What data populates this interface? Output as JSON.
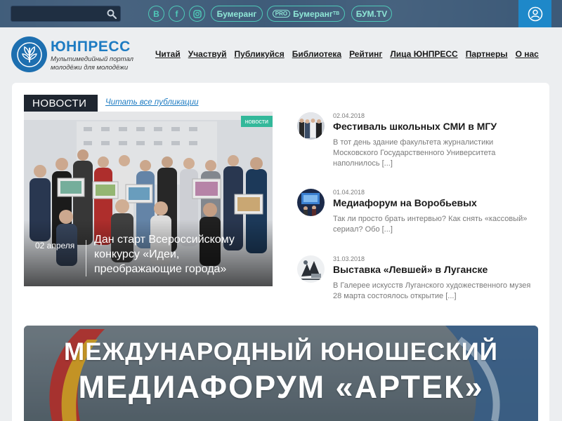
{
  "topbar": {
    "search": {
      "value": "",
      "placeholder": ""
    },
    "social": [
      {
        "icon": "vk-icon",
        "glyph": "В"
      },
      {
        "icon": "facebook-icon",
        "glyph": "f"
      },
      {
        "icon": "instagram-icon",
        "glyph": ""
      }
    ],
    "links": [
      {
        "label": "Бумеранг"
      },
      {
        "pro": "PRO",
        "label": "Бумеранг",
        "sup": "ТВ"
      },
      {
        "label": "БУМ.TV"
      }
    ],
    "user_icon": "user-icon"
  },
  "header": {
    "logo_title": "ЮНПРЕСС",
    "logo_subtitle": "Мультимедийный портал молодёжи для молодёжи",
    "nav": [
      "Читай",
      "Участвуй",
      "Публикуйся",
      "Библиотека",
      "Рейтинг",
      "Лица ЮНПРЕСС",
      "Партнеры",
      "О нас"
    ]
  },
  "news": {
    "tab_label": "НОВОСТИ",
    "read_all": "Читать все публикации",
    "hero": {
      "badge": "новости",
      "date": "02 апреля",
      "title": "Дан старт Всероссийскому конкурсу «Идеи, преображающие города»"
    },
    "items": [
      {
        "date": "02.04.2018",
        "title": "Фестиваль школьных СМИ в МГУ",
        "text": "В тот день здание факультета журналистики Московского Государственного Университета наполнилось [...]"
      },
      {
        "date": "01.04.2018",
        "title": "Медиафорум на Воробьевых",
        "text": "Так ли просто брать интервью? Как снять «кассовый» сериал? Обо [...]"
      },
      {
        "date": "31.03.2018",
        "title": "Выставка «Левшей» в Луганске",
        "text": "В Галерее искусств Луганского художественного музея 28 марта состоялось открытие [...]"
      }
    ]
  },
  "banner": {
    "line1": "МЕЖДУНАРОДНЫЙ ЮНОШЕСКИЙ",
    "line2": "МЕДИАФОРУМ «АРТЕК»"
  },
  "colors": {
    "topbar": "#3d5a78",
    "accent": "#1d7bc2",
    "teal": "#4fc9b8",
    "badge": "#33b89a"
  }
}
